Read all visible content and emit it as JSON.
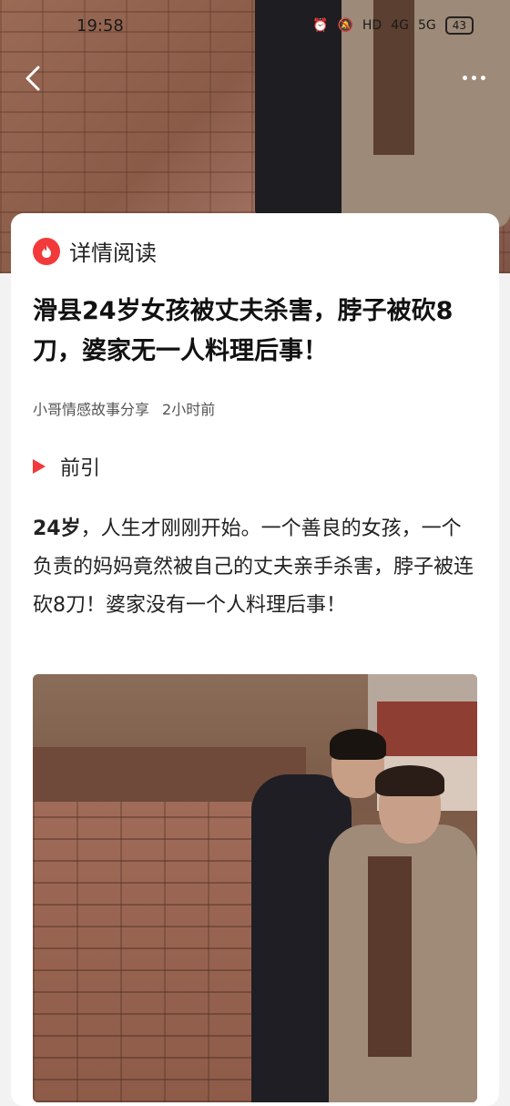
{
  "status_bar": {
    "time": "19:58",
    "battery": "43",
    "net_labels": [
      "HD",
      "4G",
      "5G"
    ]
  },
  "nav": {
    "back_icon": "chevron-left-icon",
    "more_icon": "more-dots-icon"
  },
  "card": {
    "header_label": "详情阅读",
    "header_icon": "fire-icon",
    "accent_color": "#f23a3a",
    "title": "滑县24岁女孩被丈夫杀害，脖子被砍8刀，婆家无一人料理后事！",
    "author": "小哥情感故事分享",
    "time_ago": "2小时前",
    "section_label": "前引",
    "intro_bold": "24岁",
    "intro_rest": "，人生才刚刚开始。一个善良的女孩，一个负责的妈妈竟然被自己的丈夫亲手杀害，脖子被连砍8刀！婆家没有一个人料理后事！"
  }
}
